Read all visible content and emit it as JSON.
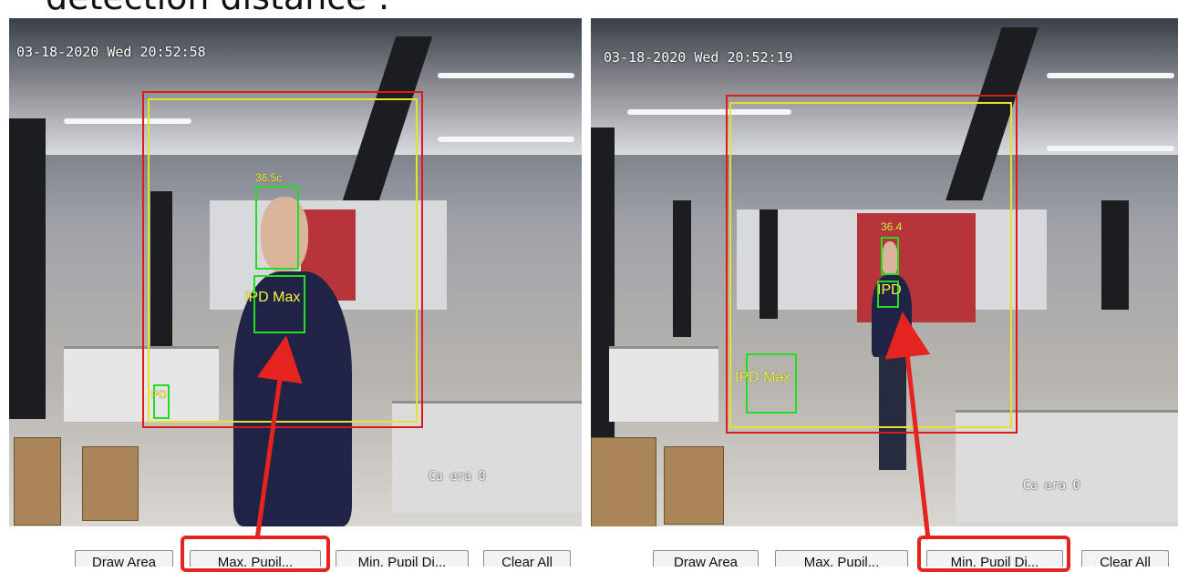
{
  "heading": "detection distance :",
  "colors": {
    "detection_box": "#e01a1a",
    "roi_box": "#e9e02a",
    "face_box": "#22dd22",
    "highlight": "#e5231f"
  },
  "left_panel": {
    "timestamp": "03-18-2020 Wed 20:52:58",
    "camera_caption": "Ca era 0",
    "face_label": "36.5c",
    "ipd_label": "IPD Max",
    "small_box_label": "PD",
    "toolbar": {
      "draw_area": "Draw Area",
      "max_pupil": "Max. Pupil...",
      "min_pupil": "Min. Pupil Di...",
      "clear_all": "Clear All"
    },
    "highlighted_button": "max_pupil"
  },
  "right_panel": {
    "timestamp": "03-18-2020 Wed 20:52:19",
    "camera_caption": "Ca era 0",
    "face_label": "36.4",
    "ipd_label": "IPD",
    "small_box_label": "IPD Max",
    "toolbar": {
      "draw_area": "Draw Area",
      "max_pupil": "Max. Pupil...",
      "min_pupil": "Min. Pupil Di...",
      "clear_all": "Clear All"
    },
    "highlighted_button": "min_pupil"
  }
}
